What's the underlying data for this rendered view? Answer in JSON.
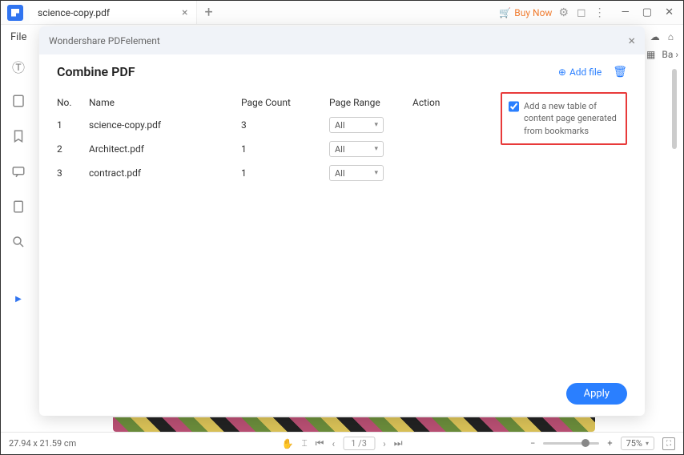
{
  "titlebar": {
    "tab_title": "science-copy.pdf",
    "buy_now": "Buy Now"
  },
  "menubar": {
    "file": "File",
    "ba": "Ba"
  },
  "modal": {
    "app_name": "Wondershare PDFelement",
    "title": "Combine PDF",
    "add_file": "Add file",
    "toc_checkbox_label": "Add a new table of content page generated from bookmarks",
    "toc_checked": true,
    "apply": "Apply",
    "columns": {
      "no": "No.",
      "name": "Name",
      "page_count": "Page Count",
      "page_range": "Page Range",
      "action": "Action"
    },
    "files": [
      {
        "no": "1",
        "name": "science-copy.pdf",
        "page_count": "3",
        "page_range": "All"
      },
      {
        "no": "2",
        "name": "Architect.pdf",
        "page_count": "1",
        "page_range": "All"
      },
      {
        "no": "3",
        "name": "contract.pdf",
        "page_count": "1",
        "page_range": "All"
      }
    ]
  },
  "status": {
    "dimensions": "27.94 x 21.59 cm",
    "page_current": "1",
    "page_total": "3",
    "zoom": "75%"
  }
}
